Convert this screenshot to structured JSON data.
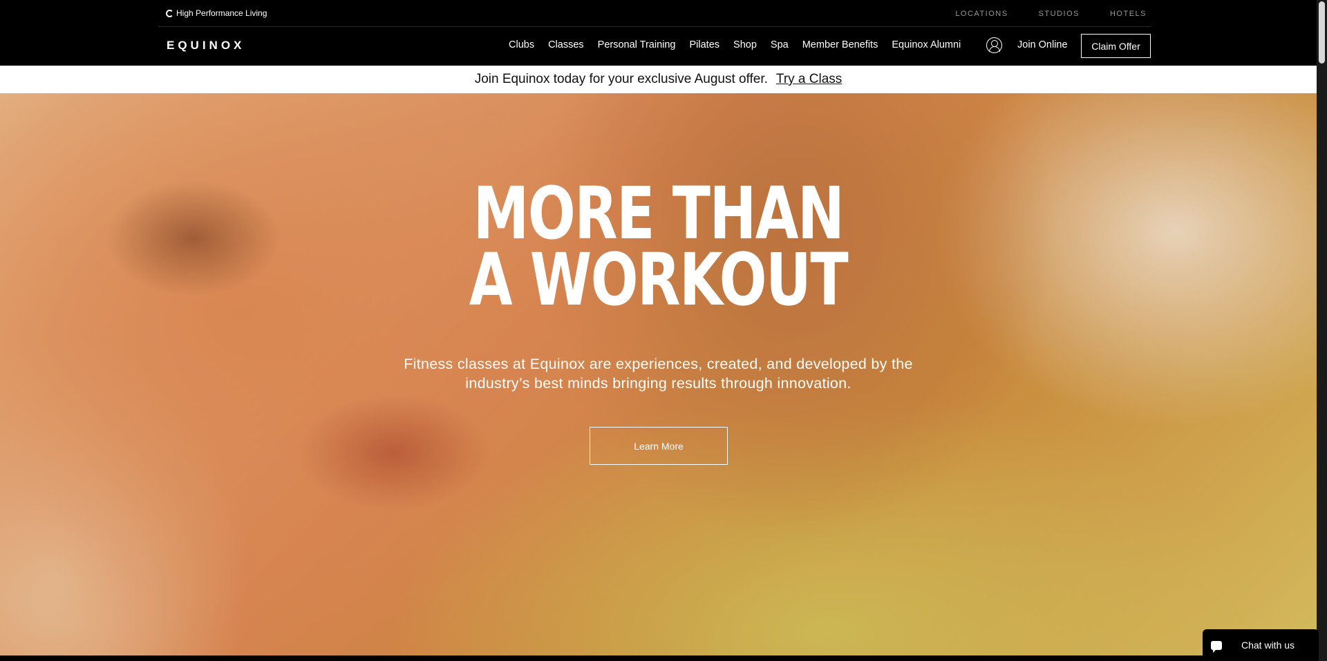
{
  "utility": {
    "tagline": "High Performance Living",
    "links": [
      "LOCATIONS",
      "STUDIOS",
      "HOTELS"
    ]
  },
  "nav": {
    "logo": "EQUINOX",
    "links": [
      "Clubs",
      "Classes",
      "Personal Training",
      "Pilates",
      "Shop",
      "Spa",
      "Member Benefits",
      "Equinox Alumni"
    ],
    "join_online": "Join Online",
    "claim_offer": "Claim Offer"
  },
  "promo": {
    "text": "Join Equinox today for your exclusive August offer.",
    "link": "Try a Class"
  },
  "hero": {
    "title_line1": "MORE THAN",
    "title_line2": "A WORKOUT",
    "desc_line1": "Fitness classes at Equinox are experiences, created, and developed by the",
    "desc_line2": "industry’s best minds bringing results through innovation.",
    "cta": "Learn More"
  },
  "chat": {
    "label": "Chat with us"
  }
}
